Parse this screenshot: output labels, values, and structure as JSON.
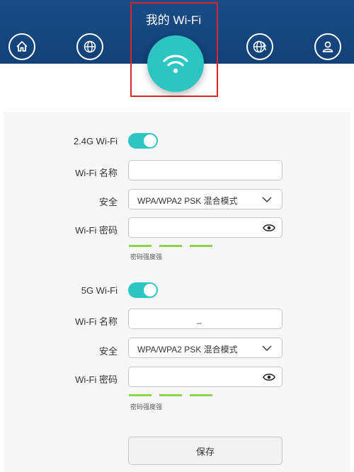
{
  "header": {
    "title": "我的 Wi-Fi",
    "nav_icons": [
      "home-icon",
      "globe-icon",
      "wifi-icon",
      "globe-network-icon",
      "user-icon"
    ]
  },
  "band_24g": {
    "toggle_label": "2.4G Wi-Fi",
    "enabled": true,
    "ssid_label": "Wi-Fi 名称",
    "ssid_value": "",
    "security_label": "安全",
    "security_value": "WPA/WPA2 PSK 混合模式",
    "password_label": "Wi-Fi 密码",
    "password_value": "",
    "strength_label": "密码强度强"
  },
  "band_5g": {
    "toggle_label": "5G Wi-Fi",
    "enabled": true,
    "ssid_label": "Wi-Fi 名称",
    "ssid_value": "_",
    "security_label": "安全",
    "security_value": "WPA/WPA2 PSK 混合模式",
    "password_label": "Wi-Fi 密码",
    "password_value": "",
    "strength_label": "密码强度强"
  },
  "actions": {
    "save_label": "保存"
  },
  "colors": {
    "header_bg": "#124177",
    "accent": "#2cc5c2",
    "strength": "#8bd24d",
    "highlight": "#d9262b"
  }
}
